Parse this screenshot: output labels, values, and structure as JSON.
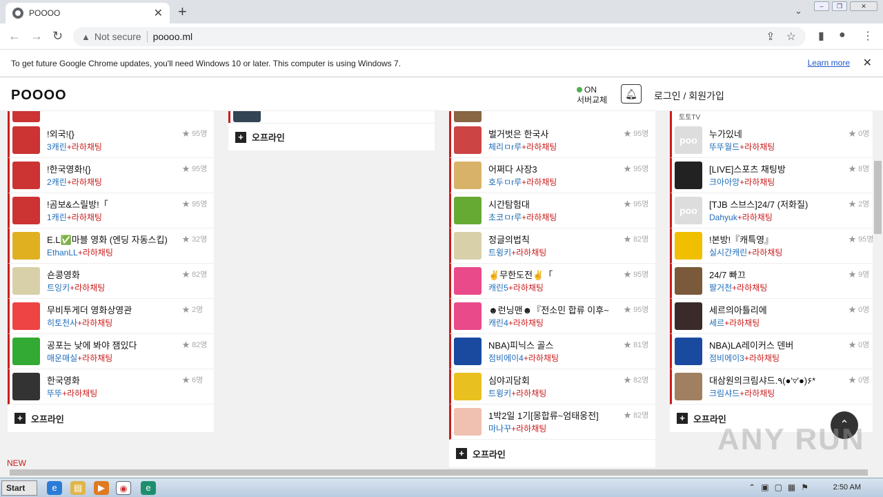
{
  "browser": {
    "tab_title": "POOOO",
    "not_secure": "Not secure",
    "url": "poooo.ml",
    "infobar_text": "To get future Google Chrome updates, you'll need Windows 10 or later. This computer is using Windows 7.",
    "learn_more": "Learn more"
  },
  "header": {
    "logo": "POOOO",
    "status_on": "ON",
    "status_label": "서버교체",
    "login": "로그인 / 회원가입"
  },
  "col1": {
    "partial_user": "",
    "rows": [
      {
        "title": "!외국!{}",
        "user": "3캐린",
        "tag": "+라하채팅",
        "count": "95명"
      },
      {
        "title": "!한국영화!{}",
        "user": "2캐린",
        "tag": "+라하채팅",
        "count": "95명"
      },
      {
        "title": "!곰보&스릴방!「",
        "user": "1캐린",
        "tag": "+라하채팅",
        "count": "95명"
      },
      {
        "title": "E.L✅마블 영화 (엔딩 자동스킵)",
        "user": "EthanLL",
        "tag": "+라하채팅",
        "count": "32명"
      },
      {
        "title": "숀콩영화",
        "user": "트잉키",
        "tag": "+라하채팅",
        "count": "82명"
      },
      {
        "title": "무비투게더 영화상영관",
        "user": "히토천사",
        "tag": "+라하채팅",
        "count": "2명"
      },
      {
        "title": "공포는 낮에 봐야 잼있다",
        "user": "매운매실",
        "tag": "+라하채팅",
        "count": "82명"
      },
      {
        "title": "한국영화",
        "user": "뚜뚜",
        "tag": "+라하채팅",
        "count": "6명"
      }
    ],
    "offline": "오프라인"
  },
  "col2": {
    "partial_user": "",
    "offline": "오프라인"
  },
  "col3": {
    "rows": [
      {
        "title": "벌거벗은 한국사",
        "user": "체리ㅁr루",
        "tag": "+라하채팅",
        "count": "95명"
      },
      {
        "title": "어쩌다 사장3",
        "user": "호두ㅁr루",
        "tag": "+라하채팅",
        "count": "95명"
      },
      {
        "title": "시간탐험대",
        "user": "초코ㅁr루",
        "tag": "+라하채팅",
        "count": "95명"
      },
      {
        "title": "정글의법칙",
        "user": "트윙키",
        "tag": "+라하채팅",
        "count": "82명"
      },
      {
        "title": "✌무한도전✌「",
        "user": "캐린5",
        "tag": "+라하채팅",
        "count": "95명"
      },
      {
        "title": "☻런닝맨☻『전소민 합류 이후~",
        "user": "캐린4",
        "tag": "+라하채팅",
        "count": "95명"
      },
      {
        "title": "NBA)피닉스 골스",
        "user": "점비에이4",
        "tag": "+라하채팅",
        "count": "81명"
      },
      {
        "title": "심야괴담회",
        "user": "트윙키",
        "tag": "+라하채팅",
        "count": "82명"
      },
      {
        "title": "1박2일 1기[몽합류~엄태웅전]",
        "user": "마나꾸",
        "tag": "+라하채팅",
        "count": "82명"
      }
    ],
    "offline": "오프라인"
  },
  "col4": {
    "rows": [
      {
        "title": "누가있네",
        "user": "뚜뚜월드",
        "tag": "+라하채팅",
        "count": "0명"
      },
      {
        "title": "[LIVE]스포츠 채팅방",
        "user": "크아아앙",
        "tag": "+라하채팅",
        "count": "8명"
      },
      {
        "title": "[TJB 스브스]24/7 (저화질)",
        "user": "Dahyuk",
        "tag": "+라하채팅",
        "count": "2명"
      },
      {
        "title": "!본방!『캐특영』",
        "user": "실시간캐린",
        "tag": "+라하채팅",
        "count": "95명"
      },
      {
        "title": "24/7 빠끄",
        "user": "팔거천",
        "tag": "+라하채팅",
        "count": "9명"
      },
      {
        "title": "세르의아틀리에",
        "user": "세르",
        "tag": "+라하채팅",
        "count": "0명"
      },
      {
        "title": "NBA)LA레이커스 덴버",
        "user": "점비에이3",
        "tag": "+라하채팅",
        "count": "0명"
      },
      {
        "title": "대삼원의크림샤드.٩(●'▿'●)۶*",
        "user": "크림샤드",
        "tag": "+라하채팅",
        "count": "0명"
      }
    ],
    "offline": "오프라인",
    "poo_label": "poo",
    "top_label": "토토TV"
  },
  "footer": {
    "new_label": "NEW",
    "watermark": "ANY RUN"
  },
  "taskbar": {
    "start": "Start",
    "clock": "2:50 AM"
  },
  "colors": {
    "accent_red": "#c91c1c",
    "user_blue": "#1e6bb8",
    "online_green": "#4caf50"
  }
}
